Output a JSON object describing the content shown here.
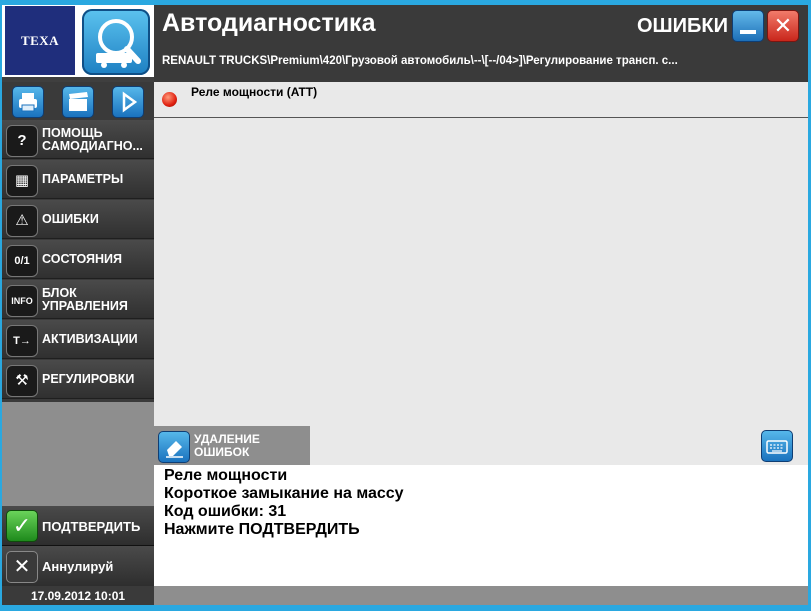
{
  "brand": {
    "logo_text": "TEXA"
  },
  "header": {
    "title": "Автодиагностика",
    "section": "ОШИБКИ",
    "breadcrumb": "RENAULT TRUCKS\\Premium\\420\\Грузовой автомобиль\\--\\[--/04>]\\Регулирование трансп. с..."
  },
  "toolbar": {
    "icons": [
      "printer-icon",
      "clapperboard-icon",
      "play-icon"
    ]
  },
  "sidebar": {
    "items": [
      {
        "label": "ПОМОЩЬ САМОДИАГНО...",
        "icon": "help-icon",
        "glyph": "?"
      },
      {
        "label": "ПАРАМЕТРЫ",
        "icon": "grid-icon",
        "glyph": "▦"
      },
      {
        "label": "ОШИБКИ",
        "icon": "warning-icon",
        "glyph": "⚠"
      },
      {
        "label": "СОСТОЯНИЯ",
        "icon": "switch-icon",
        "glyph": "0/1"
      },
      {
        "label": "БЛОК УПРАВЛЕНИЯ",
        "icon": "info-icon",
        "glyph": "INFO"
      },
      {
        "label": "АКТИВИЗАЦИИ",
        "icon": "actuator-icon",
        "glyph": "T→"
      },
      {
        "label": "РЕГУЛИРОВКИ",
        "icon": "tools-icon",
        "glyph": "🔧"
      }
    ]
  },
  "actions": {
    "confirm": "ПОДТВЕРДИТЬ",
    "cancel": "Аннулируй",
    "delete_errors": "УДАЛЕНИЕ ОШИБОК"
  },
  "status": {
    "datetime": "17.09.2012  10:01"
  },
  "errors": [
    {
      "title": "Реле мощности (ATT)",
      "status_color": "#e02010"
    }
  ],
  "info": {
    "lines": [
      "Реле мощности",
      "Короткое замыкание на массу",
      "Код ошибки: 31",
      "Нажмите ПОДТВЕРДИТЬ"
    ]
  }
}
